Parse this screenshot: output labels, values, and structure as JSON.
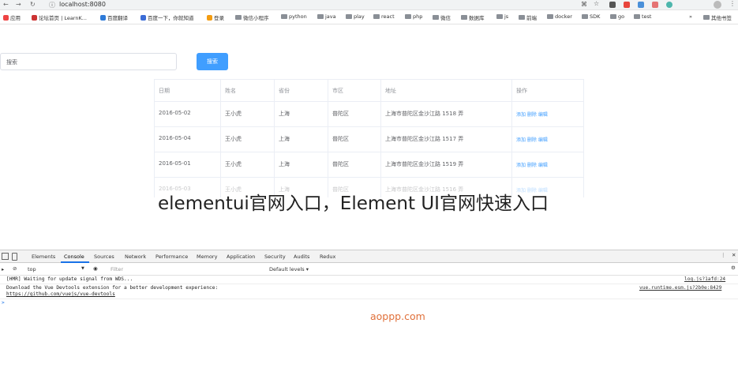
{
  "browser": {
    "url": "localhost:8080",
    "bookmarks": [
      "应用",
      "论坛首页 | LearnK...",
      "百度翻译",
      "百度一下，你就知道",
      "登录",
      "微信小程序",
      "python",
      "java",
      "play",
      "react",
      "php",
      "微信",
      "数据库",
      "js",
      "前端",
      "docker",
      "SDK",
      "go",
      "test",
      "其他书签"
    ]
  },
  "app": {
    "search_placeholder": "搜索",
    "search_button": "搜索",
    "table": {
      "headers": [
        "日期",
        "姓名",
        "省份",
        "市区",
        "地址",
        "操作"
      ],
      "rows": [
        [
          "2016-05-02",
          "王小虎",
          "上海",
          "普陀区",
          "上海市普陀区金沙江路 1518 弄",
          "添加 删除 编辑"
        ],
        [
          "2016-05-04",
          "王小虎",
          "上海",
          "普陀区",
          "上海市普陀区金沙江路 1517 弄",
          "添加 删除 编辑"
        ],
        [
          "2016-05-01",
          "王小虎",
          "上海",
          "普陀区",
          "上海市普陀区金沙江路 1519 弄",
          "添加 删除 编辑"
        ],
        [
          "2016-05-03",
          "王小虎",
          "上海",
          "普陀区",
          "上海市普陀区金沙江路 1516 弄",
          "添加 删除 编辑"
        ]
      ]
    }
  },
  "overlay_title": "elementui官网入口，Element UI官网快速入口",
  "devtools": {
    "tabs": [
      "Elements",
      "Console",
      "Sources",
      "Network",
      "Performance",
      "Memory",
      "Application",
      "Security",
      "Audits",
      "Redux"
    ],
    "active_tab": "Console",
    "context": "top",
    "filter_placeholder": "Filter",
    "levels": "Default levels ▾",
    "logs": [
      {
        "text": "[HMR] Waiting for update signal from WDS...",
        "source": "log.js?1afd:24"
      },
      {
        "text": "Download the Vue Devtools extension for a better development experience:",
        "source": "vue.runtime.esm.js?2b0e:8429"
      },
      {
        "text": "https://github.com/vuejs/vue-devtools",
        "source": ""
      }
    ],
    "prompt": ">"
  },
  "watermark": "aoppp.com"
}
